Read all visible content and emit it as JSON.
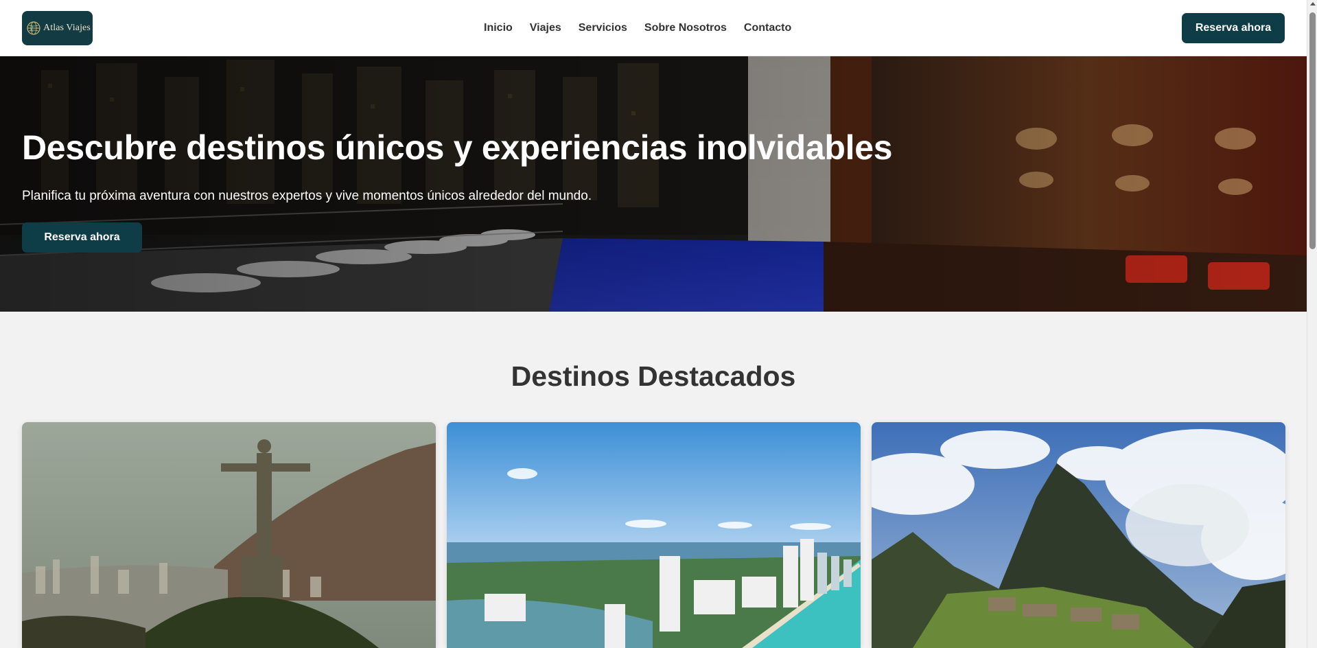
{
  "header": {
    "logo_text": "Atlas Viajes",
    "nav": [
      "Inicio",
      "Viajes",
      "Servicios",
      "Sobre Nosotros",
      "Contacto"
    ],
    "cta_label": "Reserva ahora"
  },
  "hero": {
    "title": "Descubre destinos únicos y experiencias inolvidables",
    "subtitle": "Planifica tu próxima aventura con nuestros expertos y vive momentos únicos alrededor del mundo.",
    "cta_label": "Reserva ahora"
  },
  "destinations": {
    "title": "Destinos Destacados",
    "cards": [
      {
        "image": "christ-the-redeemer-rio"
      },
      {
        "image": "miami-beach-aerial"
      },
      {
        "image": "machu-picchu"
      }
    ]
  },
  "colors": {
    "primary": "#0f3d47",
    "background": "#f2f2f2",
    "text": "#333333"
  }
}
